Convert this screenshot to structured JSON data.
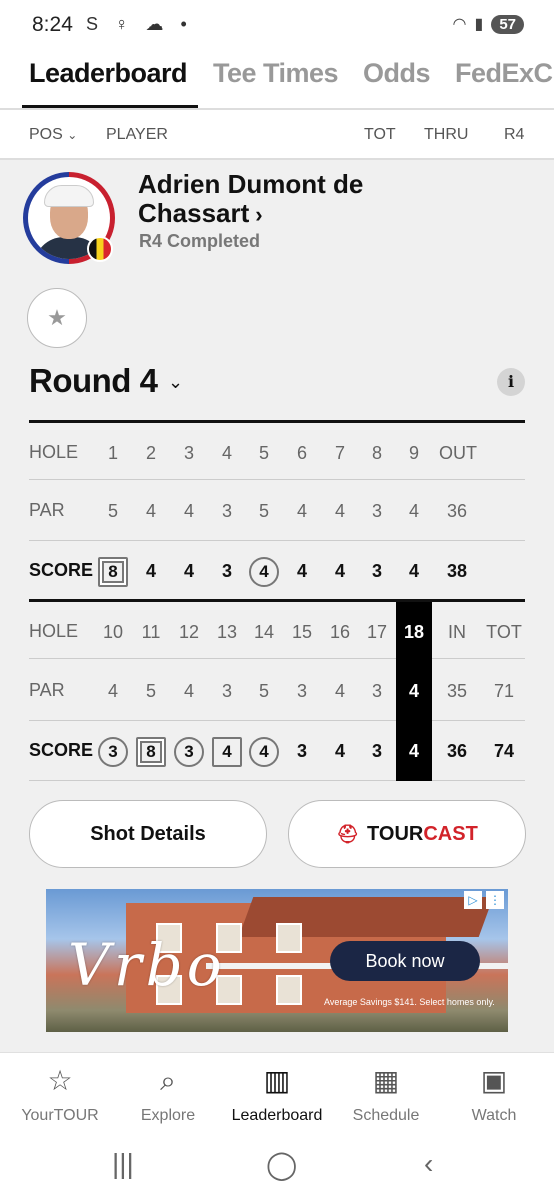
{
  "status_bar": {
    "time": "8:24",
    "battery": "57"
  },
  "tabs": [
    {
      "label": "Leaderboard",
      "active": true
    },
    {
      "label": "Tee Times",
      "active": false
    },
    {
      "label": "Odds",
      "active": false
    },
    {
      "label": "FedExCup",
      "active": false
    }
  ],
  "columns": {
    "pos": "POS",
    "player": "PLAYER",
    "tot": "TOT",
    "thru": "THRU",
    "round": "R4"
  },
  "player": {
    "name_line1": "Adrien Dumont de",
    "name_line2": "Chassart",
    "status": "R4 Completed",
    "country_flag": "Belgium"
  },
  "round": {
    "title": "Round 4",
    "info_glyph": "i"
  },
  "front_nine": {
    "hole_label": "HOLE",
    "par_label": "PAR",
    "score_label": "SCORE",
    "holes": [
      "1",
      "2",
      "3",
      "4",
      "5",
      "6",
      "7",
      "8",
      "9",
      "OUT"
    ],
    "par": [
      "5",
      "4",
      "4",
      "3",
      "5",
      "4",
      "4",
      "3",
      "4",
      "36"
    ],
    "score": [
      "8",
      "4",
      "4",
      "3",
      "4",
      "4",
      "4",
      "3",
      "4",
      "38"
    ],
    "score_marks": [
      "double-bogey",
      "",
      "",
      "",
      "birdie",
      "",
      "",
      "",
      "",
      ""
    ]
  },
  "back_nine": {
    "hole_label": "HOLE",
    "par_label": "PAR",
    "score_label": "SCORE",
    "holes": [
      "10",
      "11",
      "12",
      "13",
      "14",
      "15",
      "16",
      "17",
      "18",
      "IN",
      "TOT"
    ],
    "par": [
      "4",
      "5",
      "4",
      "3",
      "5",
      "3",
      "4",
      "3",
      "4",
      "35",
      "71"
    ],
    "score": [
      "3",
      "8",
      "3",
      "4",
      "4",
      "3",
      "4",
      "3",
      "4",
      "36",
      "74"
    ],
    "score_marks": [
      "birdie",
      "double-bogey",
      "birdie",
      "bogey",
      "birdie",
      "",
      "",
      "",
      "",
      "",
      ""
    ],
    "highlighted_hole": "18"
  },
  "buttons": {
    "shot_details": "Shot Details",
    "tourcast_a": "TOUR",
    "tourcast_b": "CAST"
  },
  "ad": {
    "brand": "Vrbo",
    "cta": "Book now",
    "fine_print": "Average Savings $141. Select homes only."
  },
  "bottom_nav": [
    {
      "label": "YourTOUR",
      "icon": "star-icon"
    },
    {
      "label": "Explore",
      "icon": "search-icon"
    },
    {
      "label": "Leaderboard",
      "icon": "bar-chart-icon",
      "active": true
    },
    {
      "label": "Schedule",
      "icon": "calendar-icon"
    },
    {
      "label": "Watch",
      "icon": "play-screen-icon"
    }
  ],
  "colors": {
    "accent_red": "#d2232a",
    "highlight": "#000000",
    "background": "#f0f0f0"
  }
}
